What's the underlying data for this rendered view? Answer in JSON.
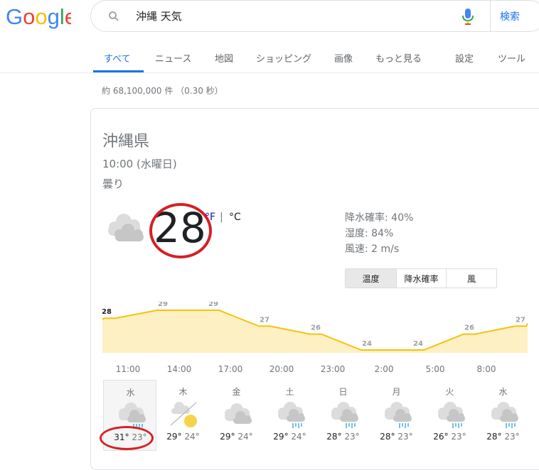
{
  "header": {
    "logo_text": "Google",
    "query": "沖縄 天気",
    "search_button": "検索"
  },
  "tabs": [
    "すべて",
    "ニュース",
    "地図",
    "ショッピング",
    "画像",
    "もっと見る",
    "設定",
    "ツール"
  ],
  "result_stats": "約 68,100,000 件 （0.30 秒）",
  "weather": {
    "location": "沖縄県",
    "datetime": "10:00 (水曜日)",
    "condition": "曇り",
    "temperature": "28",
    "unit_f": "°F",
    "unit_sep": "|",
    "unit_c": "°C",
    "precipitation": "降水確率: 40%",
    "humidity": "湿度: 84%",
    "wind": "風速: 2 m/s",
    "segments": [
      "温度",
      "降水確率",
      "風"
    ],
    "hours": [
      "11:00",
      "14:00",
      "17:00",
      "20:00",
      "23:00",
      "2:00",
      "5:00",
      "8:00"
    ],
    "days": [
      {
        "name": "水",
        "hi": "31°",
        "lo": "23°",
        "icon": "cloud-rain-icon"
      },
      {
        "name": "木",
        "hi": "29°",
        "lo": "24°",
        "icon": "cloud-sun-icon"
      },
      {
        "name": "金",
        "hi": "29°",
        "lo": "24°",
        "icon": "cloud-icon"
      },
      {
        "name": "土",
        "hi": "29°",
        "lo": "24°",
        "icon": "cloud-rain-icon"
      },
      {
        "name": "日",
        "hi": "28°",
        "lo": "23°",
        "icon": "cloud-rain-icon"
      },
      {
        "name": "月",
        "hi": "28°",
        "lo": "23°",
        "icon": "cloud-rain-icon"
      },
      {
        "name": "火",
        "hi": "26°",
        "lo": "23°",
        "icon": "cloud-rain-icon"
      },
      {
        "name": "水",
        "hi": "28°",
        "lo": "23°",
        "icon": "cloud-rain-icon"
      }
    ]
  },
  "chart_data": {
    "type": "area",
    "categories": [
      "11:00",
      "14:00",
      "17:00",
      "20:00",
      "23:00",
      "2:00",
      "5:00",
      "8:00"
    ],
    "labeled_points": [
      {
        "label": "28",
        "value": 28
      },
      {
        "label": "29",
        "value": 29
      },
      {
        "label": "29",
        "value": 29
      },
      {
        "label": "27",
        "value": 27
      },
      {
        "label": "26",
        "value": 26
      },
      {
        "label": "24",
        "value": 24
      },
      {
        "label": "24",
        "value": 24
      },
      {
        "label": "26",
        "value": 26
      },
      {
        "label": "27",
        "value": 27
      }
    ],
    "colors": {
      "line": "#f4c20d",
      "fill": "#fdf0c2"
    }
  }
}
